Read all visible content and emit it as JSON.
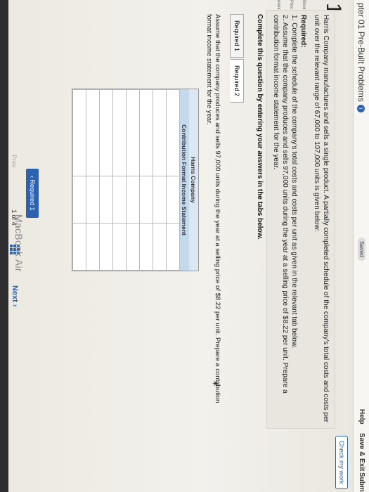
{
  "header": {
    "title": "pter 01 Pre-Built Problems",
    "info_icon": "i",
    "saved_label": "Saved",
    "help_label": "Help",
    "save_exit_label": "Save & Exit",
    "submit_label": "Submi"
  },
  "check_work_label": "Check my work",
  "question_number": "1",
  "left_tools": [
    "Book",
    "Print",
    "erences"
  ],
  "prompt": {
    "intro": "Harris Company manufactures and sells a single product. A partially completed schedule of the company's total costs and costs per unit over the relevant range of 67,000 to 107,000 units is given below:",
    "required_label": "Required:",
    "req1": "1. Complete the schedule of the company's total costs and costs per unit as given in the relevant tab below.",
    "req2": "2. Assume that the company produces and sells 97,000 units during the year at a selling price of $8.22 per unit. Prepare a contribution format income statement for the year."
  },
  "instructions": "Complete this question by entering your answers in the tabs below.",
  "tabs": [
    {
      "label": "Required 1",
      "active": false
    },
    {
      "label": "Required 2",
      "active": true
    }
  ],
  "assume_text": "Assume that the company produces and sells 97,000 units during the year at a selling price of $8.22 per unit. Prepare a contribution format income statement for the year.",
  "statement": {
    "company": "Harris Company",
    "title": "Contribution Format Income Statement",
    "rows": 8
  },
  "nav": {
    "prev_button": "Required 1",
    "prev_label": "Prev",
    "page_current": "1",
    "page_of": "of",
    "page_total": "4",
    "next_label": "Next"
  },
  "bezel_text": "MacBook Air"
}
